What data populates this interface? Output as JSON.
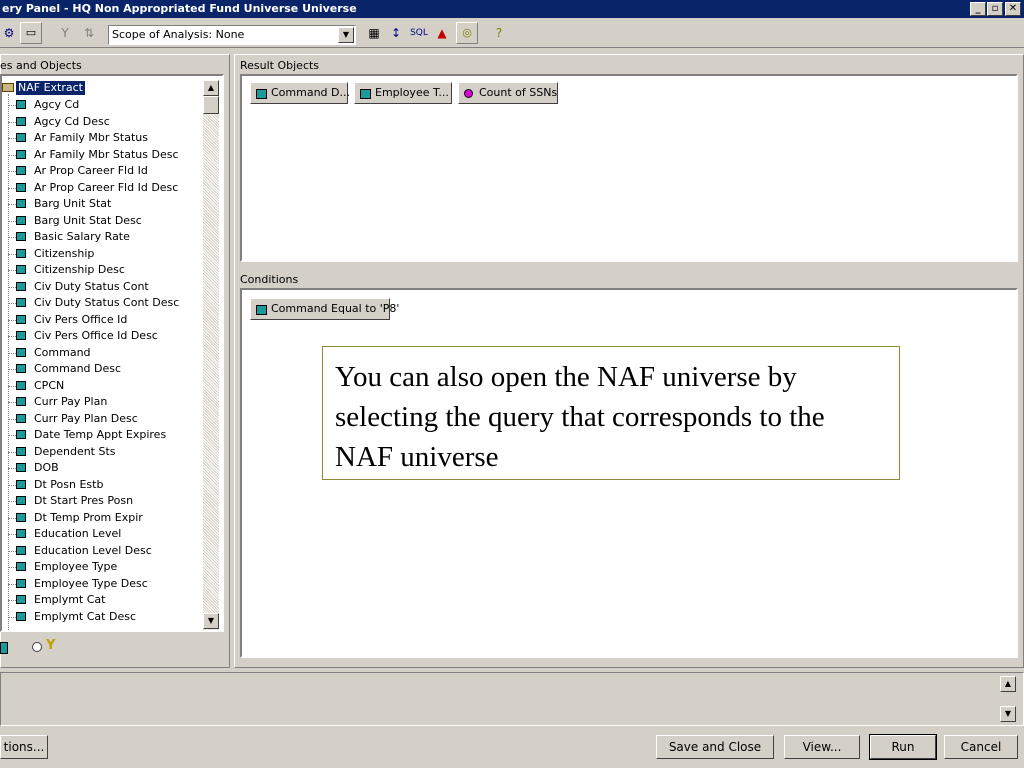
{
  "window": {
    "title": "Query Panel - HQ Non Appropriated Fund Universe Universe",
    "title_visible": "ery Panel - HQ Non Appropriated Fund Universe Universe",
    "min": "_",
    "max": "▫",
    "close": "✕"
  },
  "toolbar": {
    "scope_label": "Scope of Analysis: None"
  },
  "left_panel": {
    "header": "es and Objects",
    "root": "NAF Extract",
    "items": [
      "Agcy Cd",
      "Agcy Cd Desc",
      "Ar Family Mbr Status",
      "Ar Family Mbr Status Desc",
      "Ar Prop Career Fld Id",
      "Ar Prop Career Fld Id Desc",
      "Barg Unit Stat",
      "Barg Unit Stat Desc",
      "Basic Salary Rate",
      "Citizenship",
      "Citizenship Desc",
      "Civ Duty Status Cont",
      "Civ Duty Status Cont Desc",
      "Civ Pers Office Id",
      "Civ Pers Office Id Desc",
      "Command",
      "Command Desc",
      "CPCN",
      "Curr Pay Plan",
      "Curr Pay Plan Desc",
      "Date Temp Appt Expires",
      "Dependent Sts",
      "DOB",
      "Dt Posn Estb",
      "Dt Start Pres Posn",
      "Dt Temp Prom Expir",
      "Education Level",
      "Education Level Desc",
      "Employee Type",
      "Employee Type Desc",
      "Emplymt Cat",
      "Emplymt Cat Desc"
    ]
  },
  "result_objects": {
    "header": "Result Objects",
    "chips": [
      "Command D...",
      "Employee T...",
      "Count of SSNs"
    ]
  },
  "conditions": {
    "header": "Conditions",
    "chip": "Command Equal to 'P8'"
  },
  "note": "You can also open the NAF universe by selecting the query that corresponds to the NAF universe",
  "buttons": {
    "options": "tions...",
    "save_close": "Save and Close",
    "view": "View...",
    "run": "Run",
    "cancel": "Cancel"
  },
  "colors": {
    "title_bar": "#0a246a",
    "face": "#d4d0c8",
    "object_icon": "#1a9a9a",
    "measure_icon": "#e000e0"
  }
}
